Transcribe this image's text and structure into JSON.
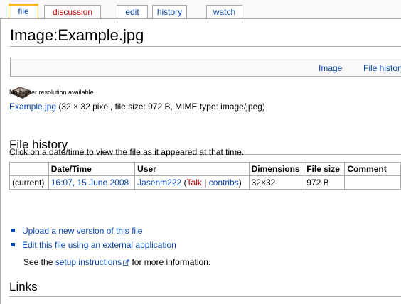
{
  "tabs": [
    {
      "label": "file",
      "selected": true
    },
    {
      "label": "discussion",
      "missing_page": true
    },
    {
      "label": "edit"
    },
    {
      "label": "history"
    },
    {
      "label": "watch"
    }
  ],
  "page": {
    "title": "Image:Example.jpg"
  },
  "filetoc": {
    "image_link": "Image",
    "file_history_link": "File history"
  },
  "thumbnail": {
    "icon": "file-thumbnail-icon"
  },
  "file_info": {
    "no_higher_res": "No higher resolution available.",
    "file_link": "Example.jpg",
    "details": "(32 × 32 pixel, file size: 972 B, MIME type: image/jpeg)"
  },
  "file_history": {
    "heading": "File history",
    "intro": "Click on a date/time to view the file as it appeared at that time.",
    "columns": [
      "",
      "Date/Time",
      "User",
      "Dimensions",
      "File size",
      "Comment"
    ],
    "rows": [
      {
        "status": "(current)",
        "datetime": "16:07, 15 June 2008",
        "user": "Jasenm222",
        "talk": "Talk",
        "separator": "|",
        "contribs": "contribs",
        "dimensions": "32×32",
        "file_size": "972 B",
        "comment": ""
      }
    ]
  },
  "actions": {
    "upload": "Upload a new version of this file",
    "edit_external": "Edit this file using an external application",
    "setup_prefix": "See the",
    "setup_link": "setup instructions",
    "setup_suffix": "for more information."
  },
  "links_section": {
    "heading": "Links"
  },
  "colors": {
    "link": "#0645ad",
    "missing_link": "#ba0000",
    "selected_tab_accent": "#fabd23",
    "border": "#aaaaaa"
  }
}
